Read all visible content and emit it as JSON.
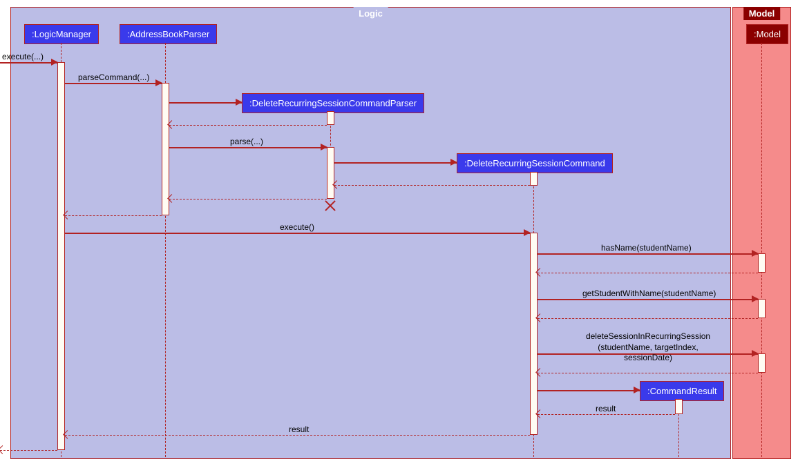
{
  "containers": {
    "logic": "Logic",
    "model": "Model"
  },
  "participants": {
    "logicManager": ":LogicManager",
    "addressBookParser": ":AddressBookParser",
    "parser": ":DeleteRecurringSessionCommandParser",
    "command": ":DeleteRecurringSessionCommand",
    "commandResult": ":CommandResult",
    "model": ":Model"
  },
  "messages": {
    "execute_in": "execute(...)",
    "parseCommand": "parseCommand(...)",
    "parse": "parse(...)",
    "execute": "execute()",
    "hasName": "hasName(studentName)",
    "getStudent": "getStudentWithName(studentName)",
    "deleteSession_l1": "deleteSessionInRecurringSession",
    "deleteSession_l2": "(studentName, targetIndex, sessionDate)",
    "result": "result"
  },
  "chart_data": {
    "type": "sequence_diagram",
    "containers": [
      {
        "name": "Logic",
        "participants": [
          "LogicManager",
          "AddressBookParser",
          "DeleteRecurringSessionCommandParser",
          "DeleteRecurringSessionCommand",
          "CommandResult"
        ]
      },
      {
        "name": "Model",
        "participants": [
          "Model"
        ]
      }
    ],
    "participants": [
      ":LogicManager",
      ":AddressBookParser",
      ":DeleteRecurringSessionCommandParser",
      ":DeleteRecurringSessionCommand",
      ":CommandResult",
      ":Model"
    ],
    "interactions": [
      {
        "from": "external",
        "to": "LogicManager",
        "message": "execute(...)",
        "type": "sync"
      },
      {
        "from": "LogicManager",
        "to": "AddressBookParser",
        "message": "parseCommand(...)",
        "type": "sync"
      },
      {
        "from": "AddressBookParser",
        "to": "DeleteRecurringSessionCommandParser",
        "message": "",
        "type": "create"
      },
      {
        "from": "DeleteRecurringSessionCommandParser",
        "to": "AddressBookParser",
        "message": "",
        "type": "return"
      },
      {
        "from": "AddressBookParser",
        "to": "DeleteRecurringSessionCommandParser",
        "message": "parse(...)",
        "type": "sync"
      },
      {
        "from": "DeleteRecurringSessionCommandParser",
        "to": "DeleteRecurringSessionCommand",
        "message": "",
        "type": "create"
      },
      {
        "from": "DeleteRecurringSessionCommand",
        "to": "DeleteRecurringSessionCommandParser",
        "message": "",
        "type": "return"
      },
      {
        "from": "DeleteRecurringSessionCommandParser",
        "to": "AddressBookParser",
        "message": "",
        "type": "return"
      },
      {
        "from": "DeleteRecurringSessionCommandParser",
        "to": "",
        "message": "",
        "type": "destroy"
      },
      {
        "from": "AddressBookParser",
        "to": "LogicManager",
        "message": "",
        "type": "return"
      },
      {
        "from": "LogicManager",
        "to": "DeleteRecurringSessionCommand",
        "message": "execute()",
        "type": "sync"
      },
      {
        "from": "DeleteRecurringSessionCommand",
        "to": "Model",
        "message": "hasName(studentName)",
        "type": "sync"
      },
      {
        "from": "Model",
        "to": "DeleteRecurringSessionCommand",
        "message": "",
        "type": "return"
      },
      {
        "from": "DeleteRecurringSessionCommand",
        "to": "Model",
        "message": "getStudentWithName(studentName)",
        "type": "sync"
      },
      {
        "from": "Model",
        "to": "DeleteRecurringSessionCommand",
        "message": "",
        "type": "return"
      },
      {
        "from": "DeleteRecurringSessionCommand",
        "to": "Model",
        "message": "deleteSessionInRecurringSession(studentName, targetIndex, sessionDate)",
        "type": "sync"
      },
      {
        "from": "Model",
        "to": "DeleteRecurringSessionCommand",
        "message": "",
        "type": "return"
      },
      {
        "from": "DeleteRecurringSessionCommand",
        "to": "CommandResult",
        "message": "",
        "type": "create"
      },
      {
        "from": "CommandResult",
        "to": "DeleteRecurringSessionCommand",
        "message": "result",
        "type": "return"
      },
      {
        "from": "DeleteRecurringSessionCommand",
        "to": "LogicManager",
        "message": "result",
        "type": "return"
      },
      {
        "from": "LogicManager",
        "to": "external",
        "message": "",
        "type": "return"
      }
    ]
  }
}
